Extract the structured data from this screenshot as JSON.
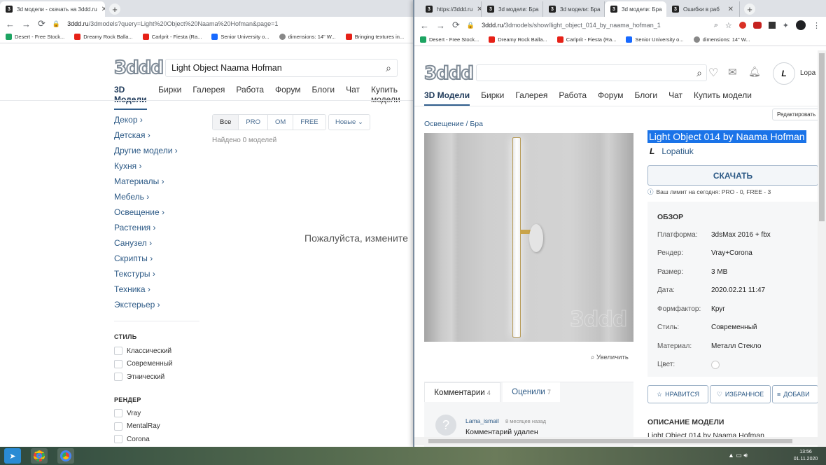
{
  "win1": {
    "tab_title": "3d модели - скачать на 3ddd.ru",
    "url": "3ddd.ru/3dmodels?query=Light%20Object%20Naama%20Hofman&page=1",
    "url_host": "3ddd.ru",
    "url_rest": "/3dmodels?query=Light%20Object%20Naama%20Hofman&page=1",
    "bookmarks": [
      "Desert - Free Stock...",
      "Dreamy Rock Balla...",
      "Carlprit - Fiesta (Ra...",
      "Senior University o...",
      "dimensions: 14\" W...",
      "Bringing textures in..."
    ],
    "logo": "3ddd",
    "search_value": "Light Object Naama Hofman",
    "nav": [
      "3D Модели",
      "Бирки",
      "Галерея",
      "Работа",
      "Форум",
      "Блоги",
      "Чат",
      "Купить модели"
    ],
    "categories": [
      "Декор",
      "Детская",
      "Другие модели",
      "Кухня",
      "Материалы",
      "Мебель",
      "Освещение",
      "Растения",
      "Санузел",
      "Скрипты",
      "Текстуры",
      "Техника",
      "Экстерьер"
    ],
    "style_heading": "СТИЛЬ",
    "styles": [
      "Классический",
      "Современный",
      "Этнический"
    ],
    "render_heading": "РЕНДЕР",
    "renders": [
      "Vray",
      "MentalRay",
      "Corona"
    ],
    "filters": [
      "Все",
      "PRO",
      "ОМ",
      "FREE"
    ],
    "sort": "Новые",
    "found": "Найдено 0 моделей",
    "empty_msg": "Пожалуйста, измените"
  },
  "win2": {
    "tabs": [
      "https://3ddd.ru",
      "3d модели: Бра",
      "3d модели: Бра",
      "3d модели: Бра",
      "Ошибки в раб"
    ],
    "url_host": "3ddd.ru",
    "url_rest": "/3dmodels/show/light_object_014_by_naama_hofman_1",
    "bookmarks": [
      "Desert - Free Stock...",
      "Dreamy Rock Balla...",
      "Carlprit - Fiesta (Ra...",
      "Senior University o...",
      "dimensions: 14\" W..."
    ],
    "logo": "3ddd",
    "user_short": "Lopa",
    "nav": [
      "3D Модели",
      "Бирки",
      "Галерея",
      "Работа",
      "Форум",
      "Блоги",
      "Чат",
      "Купить модели"
    ],
    "edit_btn": "Редактировать",
    "breadcrumb": "Освещение / Бра",
    "title": "Light Object 014 by Naama Hofman",
    "author": "Lopatiuk",
    "download": "СКАЧАТЬ",
    "limit": "Ваш лимит на сегодня: PRO - 0, FREE - 3",
    "overview_heading": "ОБЗОР",
    "specs": [
      {
        "k": "Платформа:",
        "v": "3dsMax 2016 + fbx"
      },
      {
        "k": "Рендер:",
        "v": "Vray+Corona"
      },
      {
        "k": "Размер:",
        "v": "3 MB"
      },
      {
        "k": "Дата:",
        "v": "2020.02.21 11:47"
      },
      {
        "k": "Формфактор:",
        "v": "Круг"
      },
      {
        "k": "Стиль:",
        "v": "Современный"
      },
      {
        "k": "Материал:",
        "v": "Металл Стекло"
      },
      {
        "k": "Цвет:",
        "v": ""
      }
    ],
    "watermark": "3ddd",
    "zoom": "Увеличить",
    "comments_tab": "Комментарии",
    "comments_count": "4",
    "rated_tab": "Оценили",
    "rated_count": "7",
    "comment_user": "Lama_ismail",
    "comment_time": "8 месяцев назад",
    "comment_text": "Комментарий удален",
    "like_btn": "НРАВИТСЯ",
    "fav_btn": "ИЗБРАННОЕ",
    "add_btn": "ДОБАВИ",
    "desc_heading": "ОПИСАНИЕ МОДЕЛИ",
    "desc_text": "Light Object 014 by Naama Hofman"
  },
  "taskbar": {
    "time": "13:56",
    "date": "01.11.2020"
  },
  "colors": {
    "accent": "#2d5a86",
    "selection": "#1a73e8"
  }
}
